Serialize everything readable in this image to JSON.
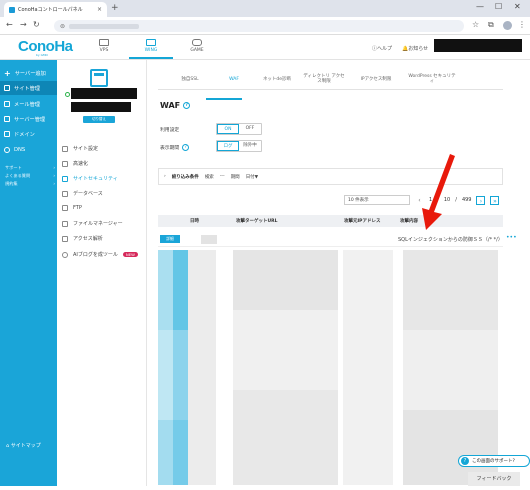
{
  "browser": {
    "tab_title": "ConoHaコントロールパネル",
    "new_tab": "+",
    "close": "×",
    "minimize": "—",
    "maximize": "☐",
    "window_close": "✕"
  },
  "header": {
    "logo": "ConoHa",
    "logo_sub": "by GMO",
    "services": [
      {
        "label": "VPS",
        "icon": "server-icon"
      },
      {
        "label": "WING",
        "icon": "wing-icon"
      },
      {
        "label": "GAME",
        "icon": "gamepad-icon"
      }
    ],
    "help": "ヘルプ",
    "notice": "お知らせ"
  },
  "sidenav": {
    "items": [
      {
        "label": "サーバー追加",
        "icon": "plus-icon"
      },
      {
        "label": "サイト管理",
        "icon": "site-icon"
      },
      {
        "label": "メール管理",
        "icon": "mail-icon"
      },
      {
        "label": "サーバー管理",
        "icon": "server-icon"
      },
      {
        "label": "ドメイン",
        "icon": "domain-icon"
      },
      {
        "label": "DNS",
        "icon": "dns-icon"
      }
    ],
    "sub": [
      {
        "label": "サポート",
        "arrow": "›"
      },
      {
        "label": "よくある質問",
        "arrow": "›"
      },
      {
        "label": "規約集",
        "arrow": "›"
      }
    ],
    "sitemap": "サイトマップ"
  },
  "sitepanel": {
    "button": "切り替え",
    "menu": [
      {
        "label": "サイト設定",
        "icon": "settings-icon"
      },
      {
        "label": "高速化",
        "icon": "speed-icon"
      },
      {
        "label": "サイトセキュリティ",
        "icon": "shield-icon"
      },
      {
        "label": "データベース",
        "icon": "database-icon"
      },
      {
        "label": "FTP",
        "icon": "ftp-icon"
      },
      {
        "label": "ファイルマネージャー",
        "icon": "folder-icon"
      },
      {
        "label": "アクセス解析",
        "icon": "chart-icon"
      },
      {
        "label": "AIブログを成ツール",
        "icon": "ai-icon"
      }
    ],
    "new_badge": "NEW"
  },
  "main": {
    "tabs": [
      {
        "label": "独自SSL"
      },
      {
        "label": "WAF"
      },
      {
        "label": "ネットde診断"
      },
      {
        "label": "ディレクトリ アクセス制限"
      },
      {
        "label": "IPアクセス制限"
      },
      {
        "label": "WordPress セキュリティ"
      }
    ],
    "title": "WAF",
    "settings": {
      "usage_label": "利用設定",
      "usage_on": "ON",
      "usage_off": "OFF",
      "period_label": "表示期間",
      "period_log": "ログ",
      "period_exclude": "除外中"
    },
    "filter": {
      "label": "絞り込み条件",
      "search": "検索",
      "dash": "---",
      "period": "期間",
      "date": "日付▼"
    },
    "pagination": {
      "per_page": "10 件表示",
      "current": "1",
      "sep": "/",
      "of": "10",
      "total": "499",
      "prev": "‹",
      "next": "›",
      "last": "»"
    },
    "table": {
      "headers": [
        "日時",
        "攻撃ターゲットURL",
        "攻撃元IPアドレス",
        "攻撃内容"
      ],
      "detail_button": "詳細",
      "attack_text": "SQLインジェクションからの防御ＳＳ（/* */）",
      "more": "•••"
    }
  },
  "support": {
    "label": "この画面のサポート?",
    "icon": "?"
  },
  "feedback": "フィードバック",
  "colors": {
    "accent": "#1aa5d8",
    "arrow": "#e8190b",
    "new_badge": "#d6285a"
  }
}
